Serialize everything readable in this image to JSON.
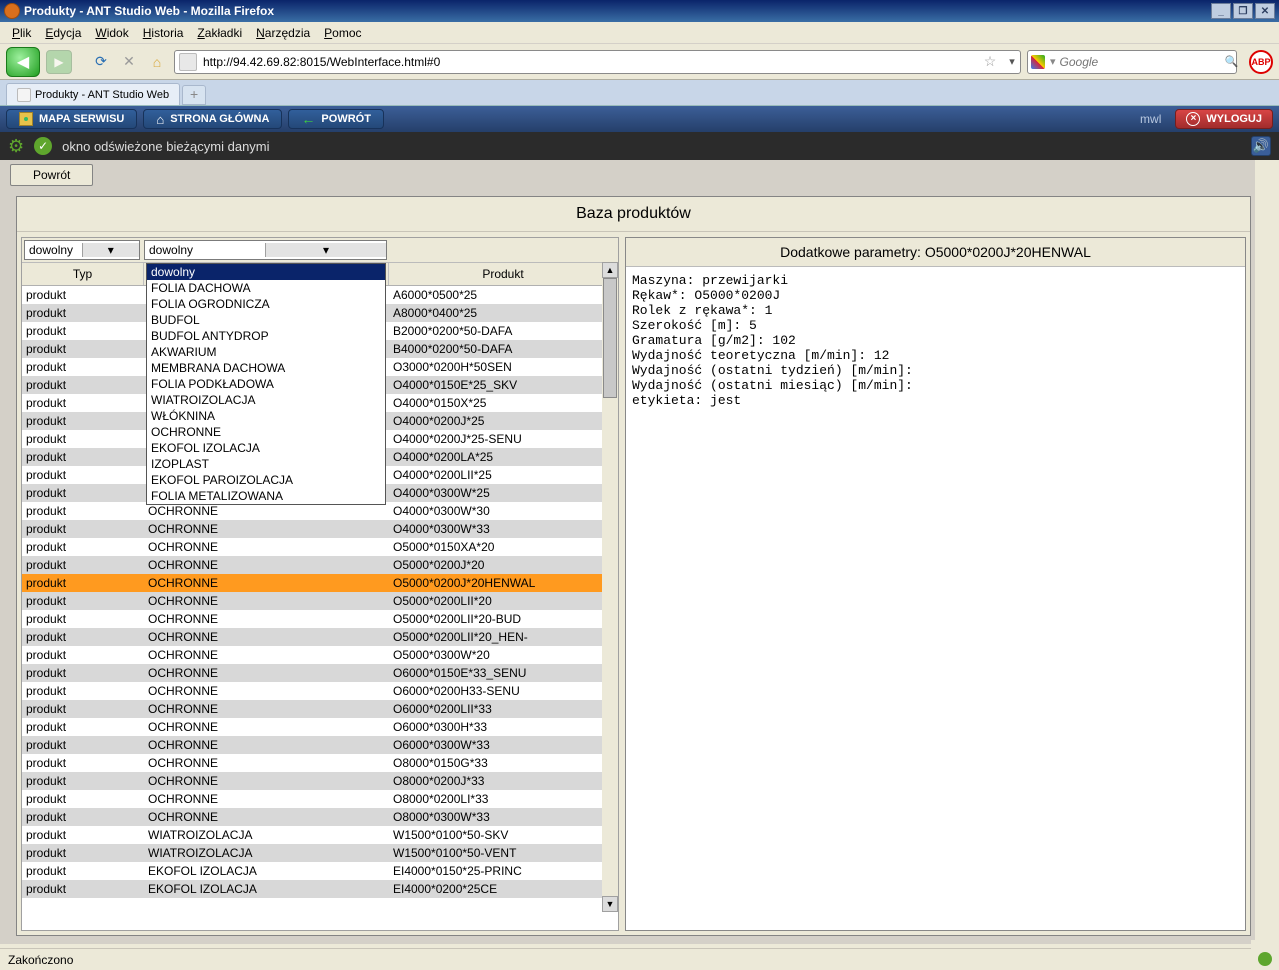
{
  "window": {
    "title": "Produkty - ANT Studio Web - Mozilla Firefox"
  },
  "menubar": [
    "Plik",
    "Edycja",
    "Widok",
    "Historia",
    "Zakładki",
    "Narzędzia",
    "Pomoc"
  ],
  "toolbar": {
    "url": "http://94.42.69.82:8015/WebInterface.html#0",
    "search_placeholder": "Google"
  },
  "tabs": [
    {
      "label": "Produkty - ANT Studio Web"
    }
  ],
  "appbar": {
    "map": "MAPA SERWISU",
    "home": "STRONA GŁÓWNA",
    "back": "POWRÓT",
    "user": "mwl",
    "logout": "WYLOGUJ"
  },
  "statusstrip": {
    "message": "okno odświeżone bieżącymi danymi"
  },
  "buttons": {
    "powrot": "Powrót"
  },
  "panel": {
    "title": "Baza produktów",
    "filter1": "dowolny",
    "filter2": "dowolny",
    "thead": {
      "typ": "Typ",
      "produkt": "Produkt"
    }
  },
  "dropdown": {
    "selected": "dowolny",
    "items": [
      "FOLIA DACHOWA",
      "FOLIA OGRODNICZA",
      "BUDFOL",
      "BUDFOL ANTYDROP",
      "AKWARIUM",
      "MEMBRANA DACHOWA",
      "FOLIA PODKŁADOWA",
      "WIATROIZOLACJA",
      "WŁÓKNINA",
      "OCHRONNE",
      "EKOFOL IZOLACJA",
      "IZOPLAST",
      "EKOFOL PAROIZOLACJA",
      "FOLIA METALIZOWANA"
    ]
  },
  "selected_row_index": 16,
  "rows": [
    {
      "typ": "produkt",
      "kat": "",
      "prod": "A6000*0500*25"
    },
    {
      "typ": "produkt",
      "kat": "",
      "prod": "A8000*0400*25"
    },
    {
      "typ": "produkt",
      "kat": "",
      "prod": "B2000*0200*50-DAFA"
    },
    {
      "typ": "produkt",
      "kat": "",
      "prod": "B4000*0200*50-DAFA"
    },
    {
      "typ": "produkt",
      "kat": "",
      "prod": "O3000*0200H*50SEN"
    },
    {
      "typ": "produkt",
      "kat": "",
      "prod": "O4000*0150E*25_SKV"
    },
    {
      "typ": "produkt",
      "kat": "",
      "prod": "O4000*0150X*25"
    },
    {
      "typ": "produkt",
      "kat": "",
      "prod": "O4000*0200J*25"
    },
    {
      "typ": "produkt",
      "kat": "",
      "prod": "O4000*0200J*25-SENU"
    },
    {
      "typ": "produkt",
      "kat": "",
      "prod": "O4000*0200LA*25"
    },
    {
      "typ": "produkt",
      "kat": "",
      "prod": "O4000*0200LII*25"
    },
    {
      "typ": "produkt",
      "kat": "",
      "prod": "O4000*0300W*25"
    },
    {
      "typ": "produkt",
      "kat": "OCHRONNE",
      "prod": "O4000*0300W*30"
    },
    {
      "typ": "produkt",
      "kat": "OCHRONNE",
      "prod": "O4000*0300W*33"
    },
    {
      "typ": "produkt",
      "kat": "OCHRONNE",
      "prod": "O5000*0150XA*20"
    },
    {
      "typ": "produkt",
      "kat": "OCHRONNE",
      "prod": "O5000*0200J*20"
    },
    {
      "typ": "produkt",
      "kat": "OCHRONNE",
      "prod": "O5000*0200J*20HENWAL"
    },
    {
      "typ": "produkt",
      "kat": "OCHRONNE",
      "prod": "O5000*0200LII*20"
    },
    {
      "typ": "produkt",
      "kat": "OCHRONNE",
      "prod": "O5000*0200LII*20-BUD"
    },
    {
      "typ": "produkt",
      "kat": "OCHRONNE",
      "prod": "O5000*0200LII*20_HEN-"
    },
    {
      "typ": "produkt",
      "kat": "OCHRONNE",
      "prod": "O5000*0300W*20"
    },
    {
      "typ": "produkt",
      "kat": "OCHRONNE",
      "prod": "O6000*0150E*33_SENU"
    },
    {
      "typ": "produkt",
      "kat": "OCHRONNE",
      "prod": "O6000*0200H33-SENU"
    },
    {
      "typ": "produkt",
      "kat": "OCHRONNE",
      "prod": "O6000*0200LII*33"
    },
    {
      "typ": "produkt",
      "kat": "OCHRONNE",
      "prod": "O6000*0300H*33"
    },
    {
      "typ": "produkt",
      "kat": "OCHRONNE",
      "prod": "O6000*0300W*33"
    },
    {
      "typ": "produkt",
      "kat": "OCHRONNE",
      "prod": "O8000*0150G*33"
    },
    {
      "typ": "produkt",
      "kat": "OCHRONNE",
      "prod": "O8000*0200J*33"
    },
    {
      "typ": "produkt",
      "kat": "OCHRONNE",
      "prod": "O8000*0200LI*33"
    },
    {
      "typ": "produkt",
      "kat": "OCHRONNE",
      "prod": "O8000*0300W*33"
    },
    {
      "typ": "produkt",
      "kat": "WIATROIZOLACJA",
      "prod": "W1500*0100*50-SKV"
    },
    {
      "typ": "produkt",
      "kat": "WIATROIZOLACJA",
      "prod": "W1500*0100*50-VENT"
    },
    {
      "typ": "produkt",
      "kat": "EKOFOL IZOLACJA",
      "prod": "EI4000*0150*25-PRINC"
    },
    {
      "typ": "produkt",
      "kat": "EKOFOL IZOLACJA",
      "prod": "EI4000*0200*25CE"
    }
  ],
  "details": {
    "title_prefix": "Dodatkowe parametry: ",
    "title_value": "O5000*0200J*20HENWAL",
    "lines": {
      "l1": "Maszyna: przewijarki",
      "l2": "Rękaw*: O5000*0200J",
      "l3": "Rolek z rękawa*: 1",
      "l4": "Szerokość [m]: 5",
      "l5": "Gramatura [g/m2]: 102",
      "l6": "Wydajność teoretyczna [m/min]: 12",
      "l7": "Wydajność (ostatni tydzień) [m/min]:",
      "l8": "Wydajność (ostatni miesiąc) [m/min]:",
      "l9": "etykieta: jest"
    }
  },
  "statusbar": {
    "text": "Zakończono"
  }
}
